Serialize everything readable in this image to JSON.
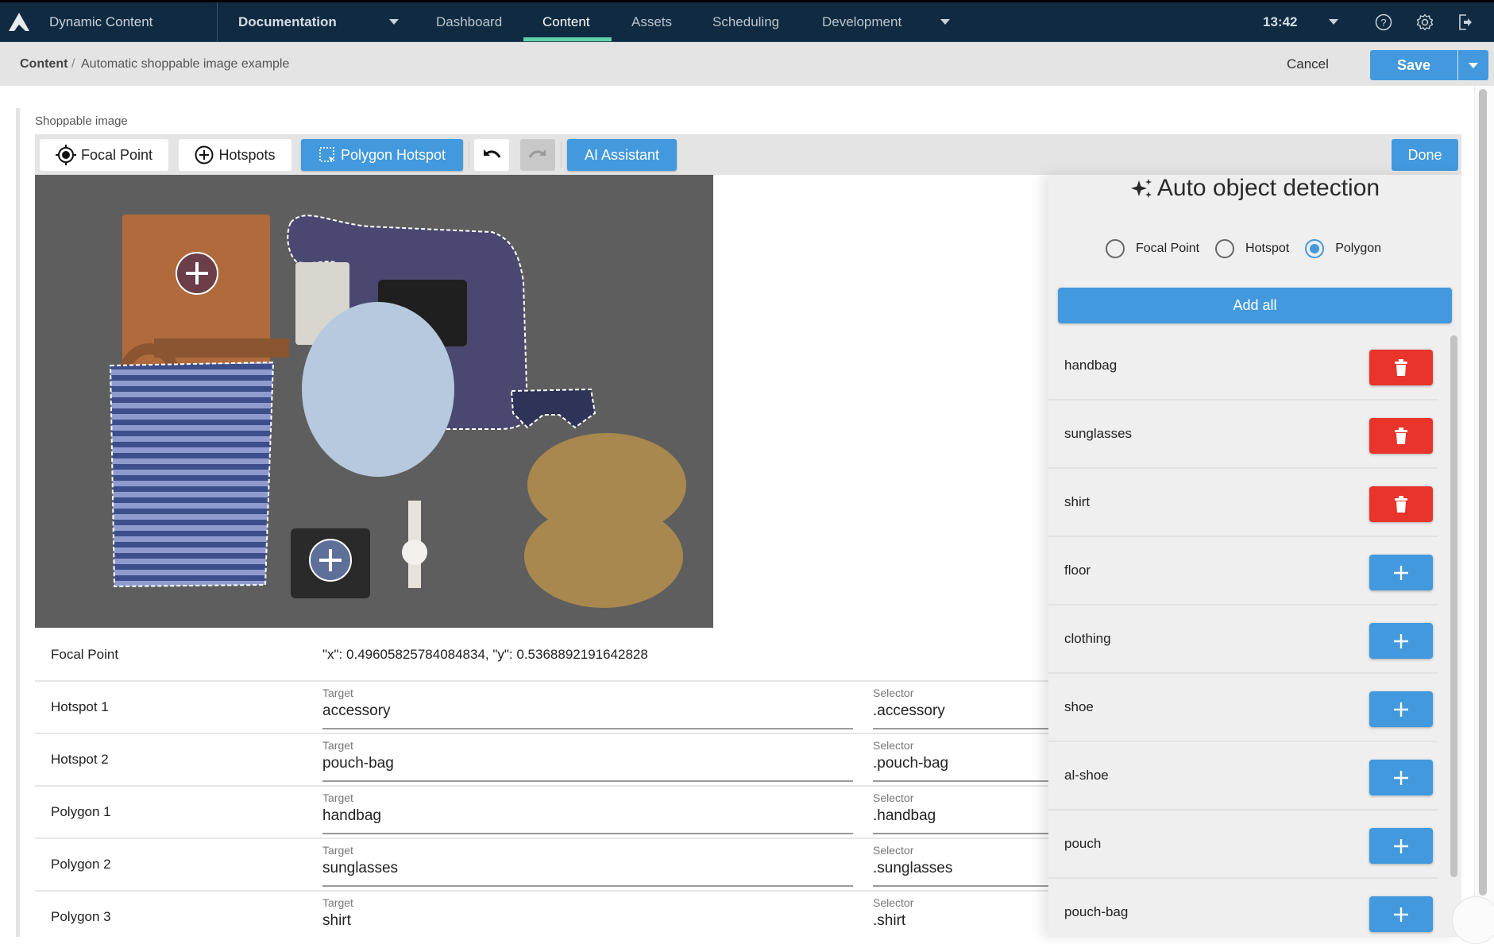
{
  "nav": {
    "app_title": "Dynamic Content",
    "org": "Documentation",
    "tabs": [
      {
        "label": "Dashboard",
        "active": false
      },
      {
        "label": "Content",
        "active": true
      },
      {
        "label": "Assets",
        "active": false
      },
      {
        "label": "Scheduling",
        "active": false
      },
      {
        "label": "Development",
        "active": false
      }
    ],
    "time": "13:42",
    "accent_color": "#5fd4aa",
    "icons": [
      "help-icon",
      "settings-icon",
      "logout-icon"
    ]
  },
  "breadcrumb": {
    "root": "Content",
    "separator": "/",
    "page": "Automatic shoppable image example"
  },
  "actions": {
    "cancel": "Cancel",
    "save": "Save"
  },
  "editor": {
    "field_label": "Shoppable image",
    "toolbar": {
      "focal_point": "Focal Point",
      "hotspots": "Hotspots",
      "polygon_hotspot": "Polygon Hotspot",
      "ai_assistant": "AI Assistant",
      "done": "Done"
    },
    "image": {
      "description": "Flat-lay of travel accessories on grey carpet: leather folio, handbag, pouch, phone, belt, scarf, sunglasses, striped shirt, camera, watch, boots",
      "polygons": [
        "handbag",
        "sunglasses",
        "shirt"
      ],
      "hotspots": [
        "accessory",
        "pouch-bag"
      ]
    }
  },
  "rows": {
    "focal_point": {
      "label": "Focal Point",
      "value": "\"x\": 0.49605825784084834, \"y\": 0.5368892191642828"
    },
    "items": [
      {
        "label": "Hotspot 1",
        "target_label": "Target",
        "target": "accessory",
        "selector_label": "Selector",
        "selector": ".accessory"
      },
      {
        "label": "Hotspot 2",
        "target_label": "Target",
        "target": "pouch-bag",
        "selector_label": "Selector",
        "selector": ".pouch-bag"
      },
      {
        "label": "Polygon 1",
        "target_label": "Target",
        "target": "handbag",
        "selector_label": "Selector",
        "selector": ".handbag"
      },
      {
        "label": "Polygon 2",
        "target_label": "Target",
        "target": "sunglasses",
        "selector_label": "Selector",
        "selector": ".sunglasses"
      },
      {
        "label": "Polygon 3",
        "target_label": "Target",
        "target": "shirt",
        "selector_label": "Selector",
        "selector": ".shirt"
      }
    ]
  },
  "panel": {
    "title": "Auto object detection",
    "modes": [
      {
        "label": "Focal Point",
        "selected": false
      },
      {
        "label": "Hotspot",
        "selected": false
      },
      {
        "label": "Polygon",
        "selected": true
      }
    ],
    "add_all": "Add all",
    "detections": [
      {
        "name": "handbag",
        "action": "remove"
      },
      {
        "name": "sunglasses",
        "action": "remove"
      },
      {
        "name": "shirt",
        "action": "remove"
      },
      {
        "name": "floor",
        "action": "add"
      },
      {
        "name": "clothing",
        "action": "add"
      },
      {
        "name": "shoe",
        "action": "add"
      },
      {
        "name": "al-shoe",
        "action": "add"
      },
      {
        "name": "pouch",
        "action": "add"
      },
      {
        "name": "pouch-bag",
        "action": "add"
      }
    ],
    "colors": {
      "primary": "#4299de",
      "danger": "#e8342a"
    }
  }
}
